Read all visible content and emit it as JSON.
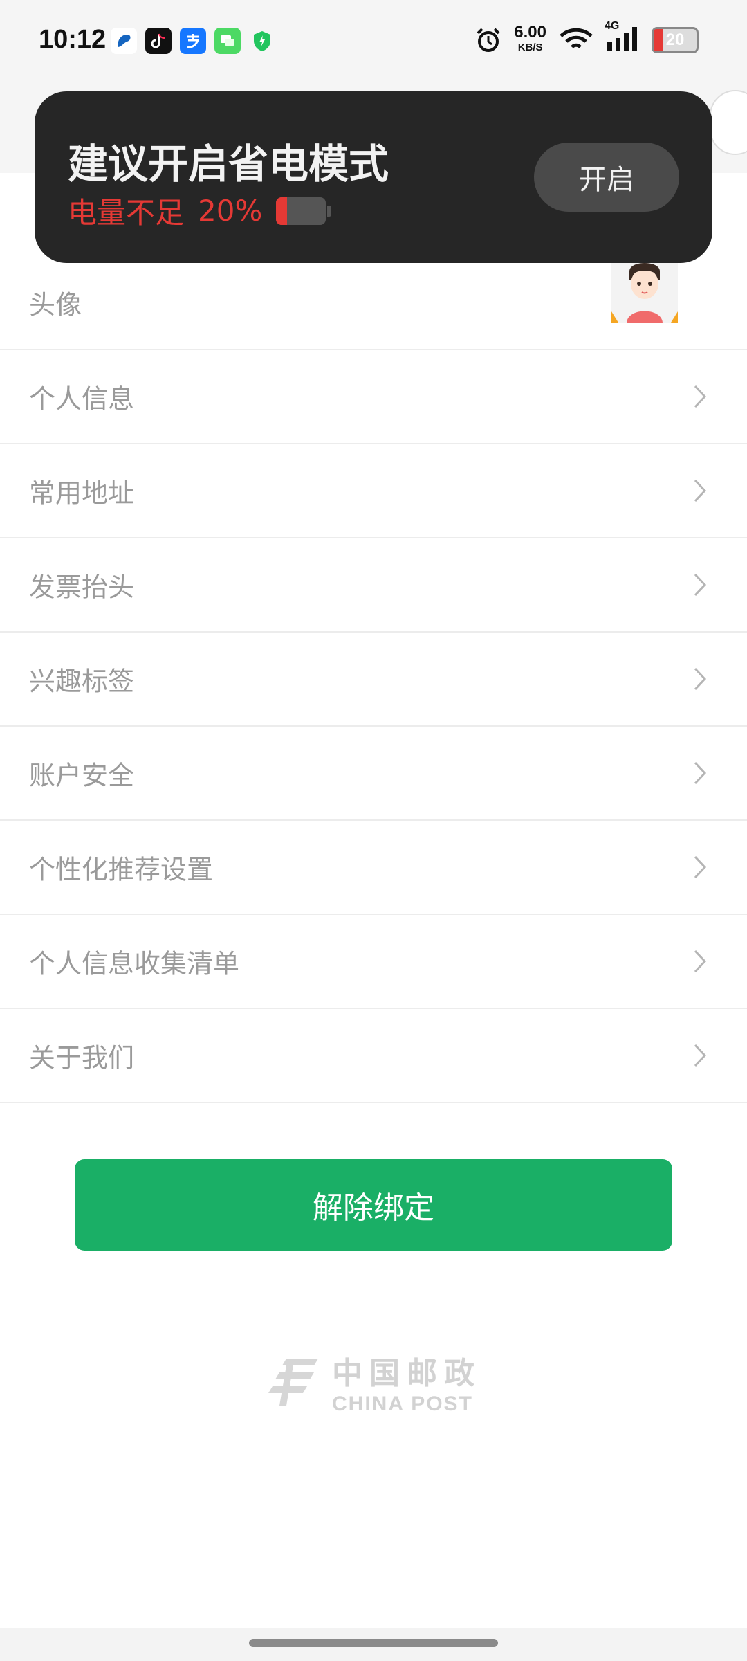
{
  "status_bar": {
    "time": "10:12",
    "net_speed": "6.00",
    "net_unit": "KB/S",
    "net_type": "4G",
    "battery": "20",
    "apps": [
      "baidu-map-icon",
      "tiktok-icon",
      "alipay-icon",
      "messages-icon",
      "security-shield-icon"
    ]
  },
  "toast": {
    "title": "建议开启省电模式",
    "subtitle": "电量不足",
    "percent": "20%",
    "button": "开启"
  },
  "settings": {
    "items": [
      {
        "label": "头像"
      },
      {
        "label": "个人信息"
      },
      {
        "label": "常用地址"
      },
      {
        "label": "发票抬头"
      },
      {
        "label": "兴趣标签"
      },
      {
        "label": "账户安全"
      },
      {
        "label": "个性化推荐设置"
      },
      {
        "label": "个人信息收集清单"
      },
      {
        "label": "关于我们"
      }
    ]
  },
  "unbind_button": "解除绑定",
  "footer_logo": {
    "cn": "中国邮政",
    "en": "CHINA POST"
  },
  "colors": {
    "accent": "#1aaf66",
    "warning": "#e53935",
    "toast_bg": "#262626"
  }
}
